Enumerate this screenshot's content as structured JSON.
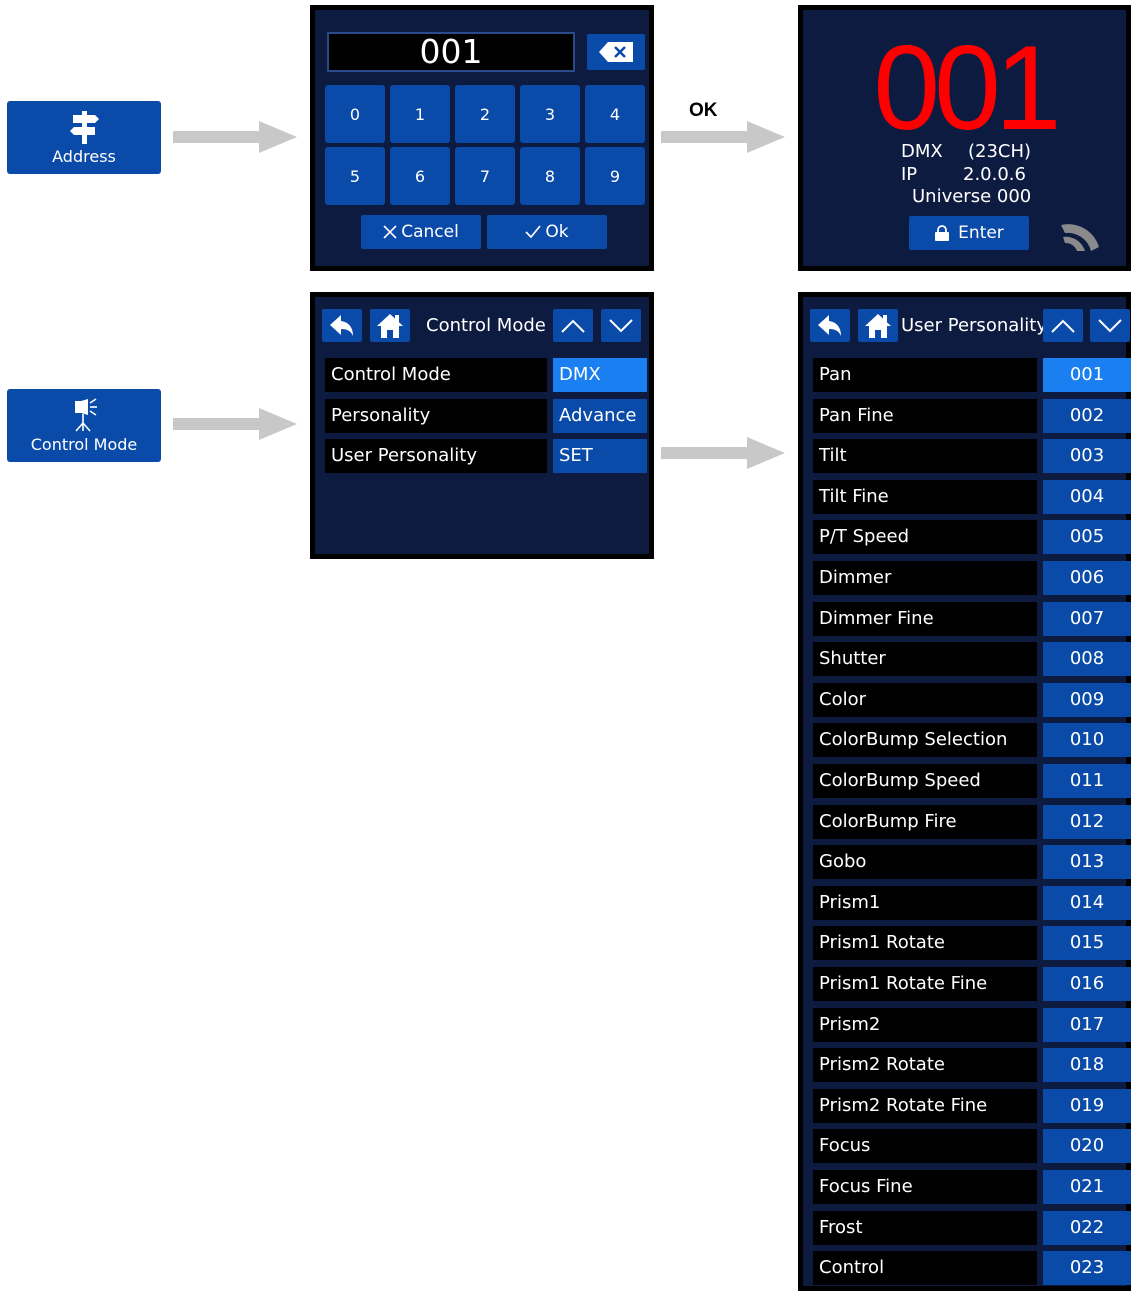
{
  "menu": {
    "address_label": "Address",
    "control_mode_label": "Control Mode"
  },
  "flow": {
    "ok_label": "OK"
  },
  "keypad": {
    "display_value": "001",
    "keys": [
      "0",
      "1",
      "2",
      "3",
      "4",
      "5",
      "6",
      "7",
      "8",
      "9"
    ],
    "cancel_label": "Cancel",
    "ok_label": "Ok"
  },
  "address_screen": {
    "address": "001",
    "mode_label": "DMX",
    "channels": "(23CH)",
    "ip_label": "IP",
    "ip_value": "2.0.0.6",
    "universe": "Universe 000",
    "enter_label": "Enter"
  },
  "control_mode_screen": {
    "title": "Control Mode",
    "rows": [
      {
        "label": "Control Mode",
        "value": "DMX"
      },
      {
        "label": "Personality",
        "value": "Advance"
      },
      {
        "label": "User Personality",
        "value": "SET"
      }
    ]
  },
  "user_personality_screen": {
    "title": "User Personality",
    "rows": [
      {
        "label": "Pan",
        "value": "001"
      },
      {
        "label": "Pan Fine",
        "value": "002"
      },
      {
        "label": "Tilt",
        "value": "003"
      },
      {
        "label": "Tilt Fine",
        "value": "004"
      },
      {
        "label": "P/T Speed",
        "value": "005"
      },
      {
        "label": "Dimmer",
        "value": "006"
      },
      {
        "label": "Dimmer Fine",
        "value": "007"
      },
      {
        "label": "Shutter",
        "value": "008"
      },
      {
        "label": "Color",
        "value": "009"
      },
      {
        "label": "ColorBump Selection",
        "value": "010"
      },
      {
        "label": "ColorBump Speed",
        "value": "011"
      },
      {
        "label": "ColorBump Fire",
        "value": "012"
      },
      {
        "label": "Gobo",
        "value": "013"
      },
      {
        "label": "Prism1",
        "value": "014"
      },
      {
        "label": "Prism1 Rotate",
        "value": "015"
      },
      {
        "label": "Prism1 Rotate Fine",
        "value": "016"
      },
      {
        "label": "Prism2",
        "value": "017"
      },
      {
        "label": "Prism2 Rotate",
        "value": "018"
      },
      {
        "label": "Prism2 Rotate Fine",
        "value": "019"
      },
      {
        "label": "Focus",
        "value": "020"
      },
      {
        "label": "Focus Fine",
        "value": "021"
      },
      {
        "label": "Frost",
        "value": "022"
      },
      {
        "label": "Control",
        "value": "023"
      }
    ]
  },
  "colors": {
    "screen_bg": "#0c1b3f",
    "button_blue": "#0a4aa8",
    "selected_blue": "#1a7ff0",
    "address_red": "#ff0000",
    "arrow_gray": "#c8c8c8"
  }
}
